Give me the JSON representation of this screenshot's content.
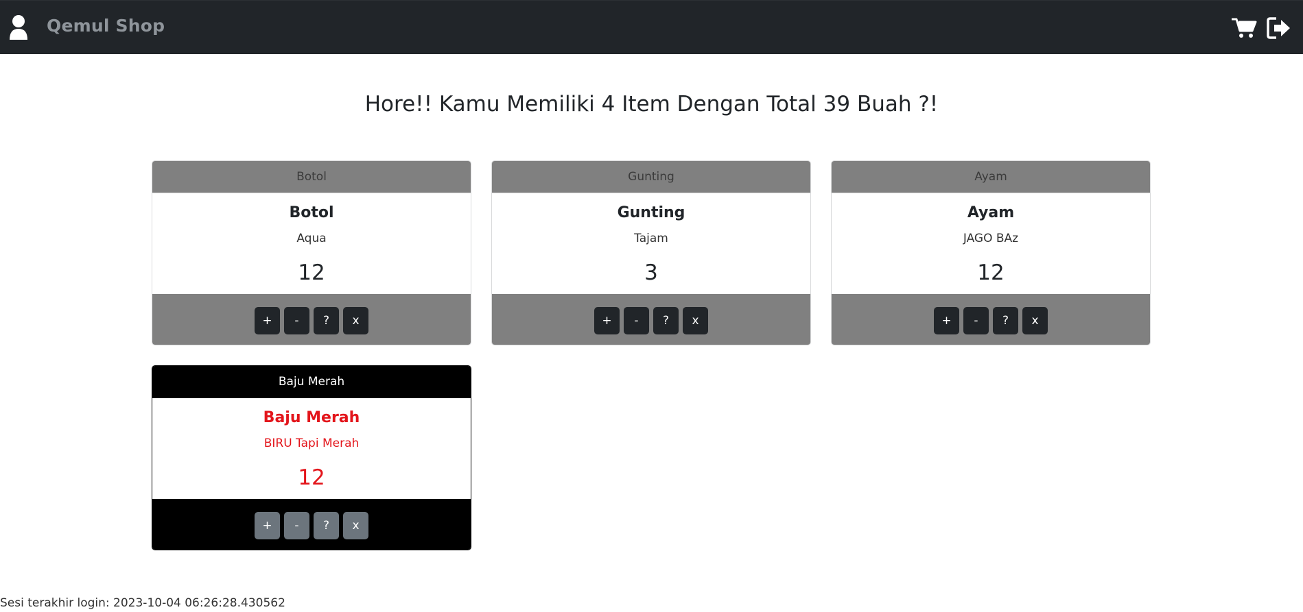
{
  "navbar": {
    "brand": "Qemul Shop",
    "icons": [
      "user-icon",
      "cart-icon",
      "logout-icon"
    ]
  },
  "headline": "Hore!! Kamu Memiliki 4 Item Dengan Total 39 Buah ?!",
  "buttons": {
    "add": "+",
    "remove": "-",
    "info": "?",
    "delete": "x"
  },
  "items": [
    {
      "header": "Botol",
      "title": "Botol",
      "description": "Aqua",
      "quantity": "12"
    },
    {
      "header": "Gunting",
      "title": "Gunting",
      "description": "Tajam",
      "quantity": "3"
    },
    {
      "header": "Ayam",
      "title": "Ayam",
      "description": "JAGO BAz",
      "quantity": "12"
    },
    {
      "header": "Baju Merah",
      "title": "Baju Merah",
      "description": "BIRU Tapi Merah",
      "quantity": "12"
    }
  ],
  "footer": {
    "last_login": "Sesi terakhir login: 2023-10-04 06:26:28.430562"
  },
  "colors": {
    "navbar_bg": "#212529",
    "card_accent": "#808080",
    "alt_card_accent": "#000000",
    "alt_text": "#e3151b",
    "button_dark": "#212529",
    "button_secondary": "#6c757d"
  }
}
